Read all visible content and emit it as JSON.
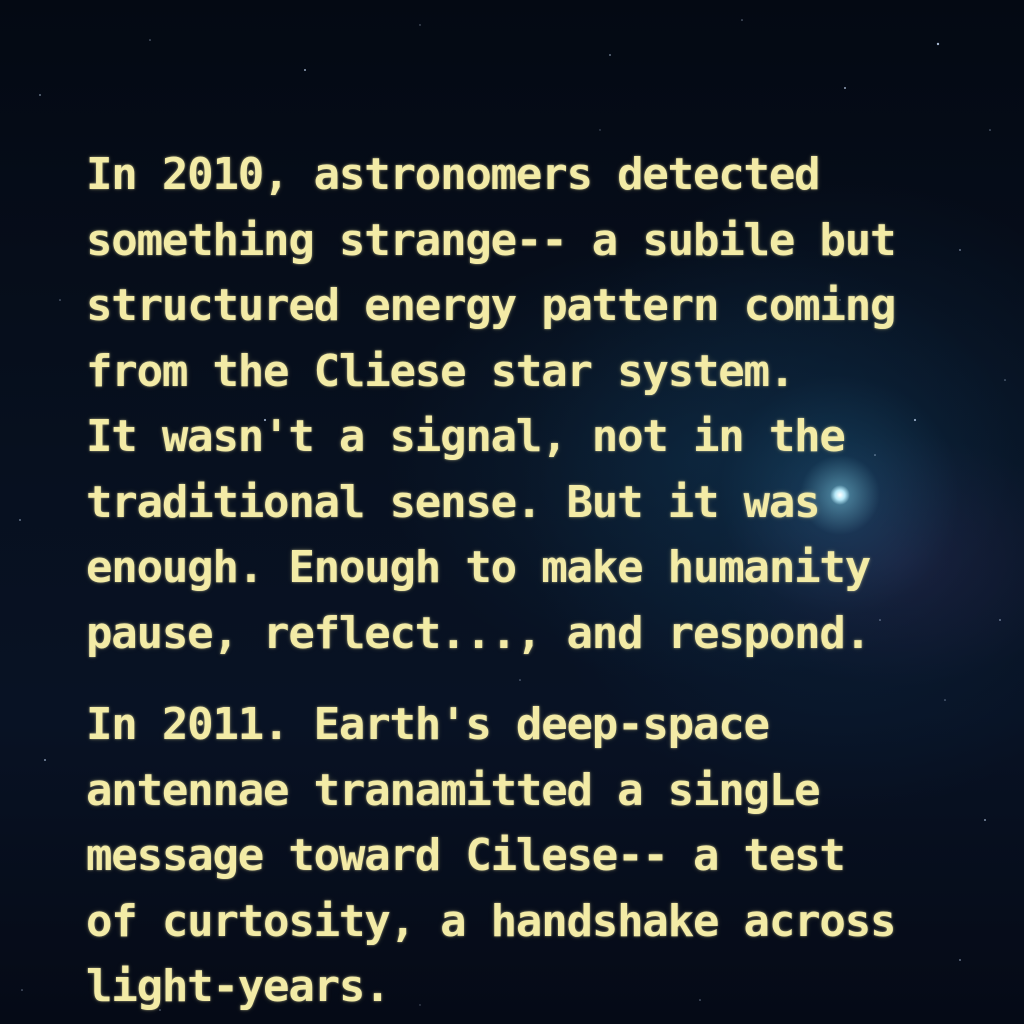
{
  "paragraphs": [
    {
      "lines": [
        "In 2010, astronomers detected",
        "something strange-- a subile but",
        "structured energy pattern coming",
        "from the Cliese star system.",
        "It wasn't a signal, not in the",
        "traditional sense. But it was",
        "enough. Enough to make humanity",
        "pause, reflect..., and respond."
      ]
    },
    {
      "lines": [
        "In 2011. Earth's deep-space",
        "antennae tranamitted a singLe",
        "message toward Cilese-- a test",
        "of curtosity, a handshake across",
        "light-years."
      ]
    }
  ],
  "colors": {
    "text": "#f3eba6",
    "background": "#050a16",
    "glow": "#9fdcf0"
  }
}
